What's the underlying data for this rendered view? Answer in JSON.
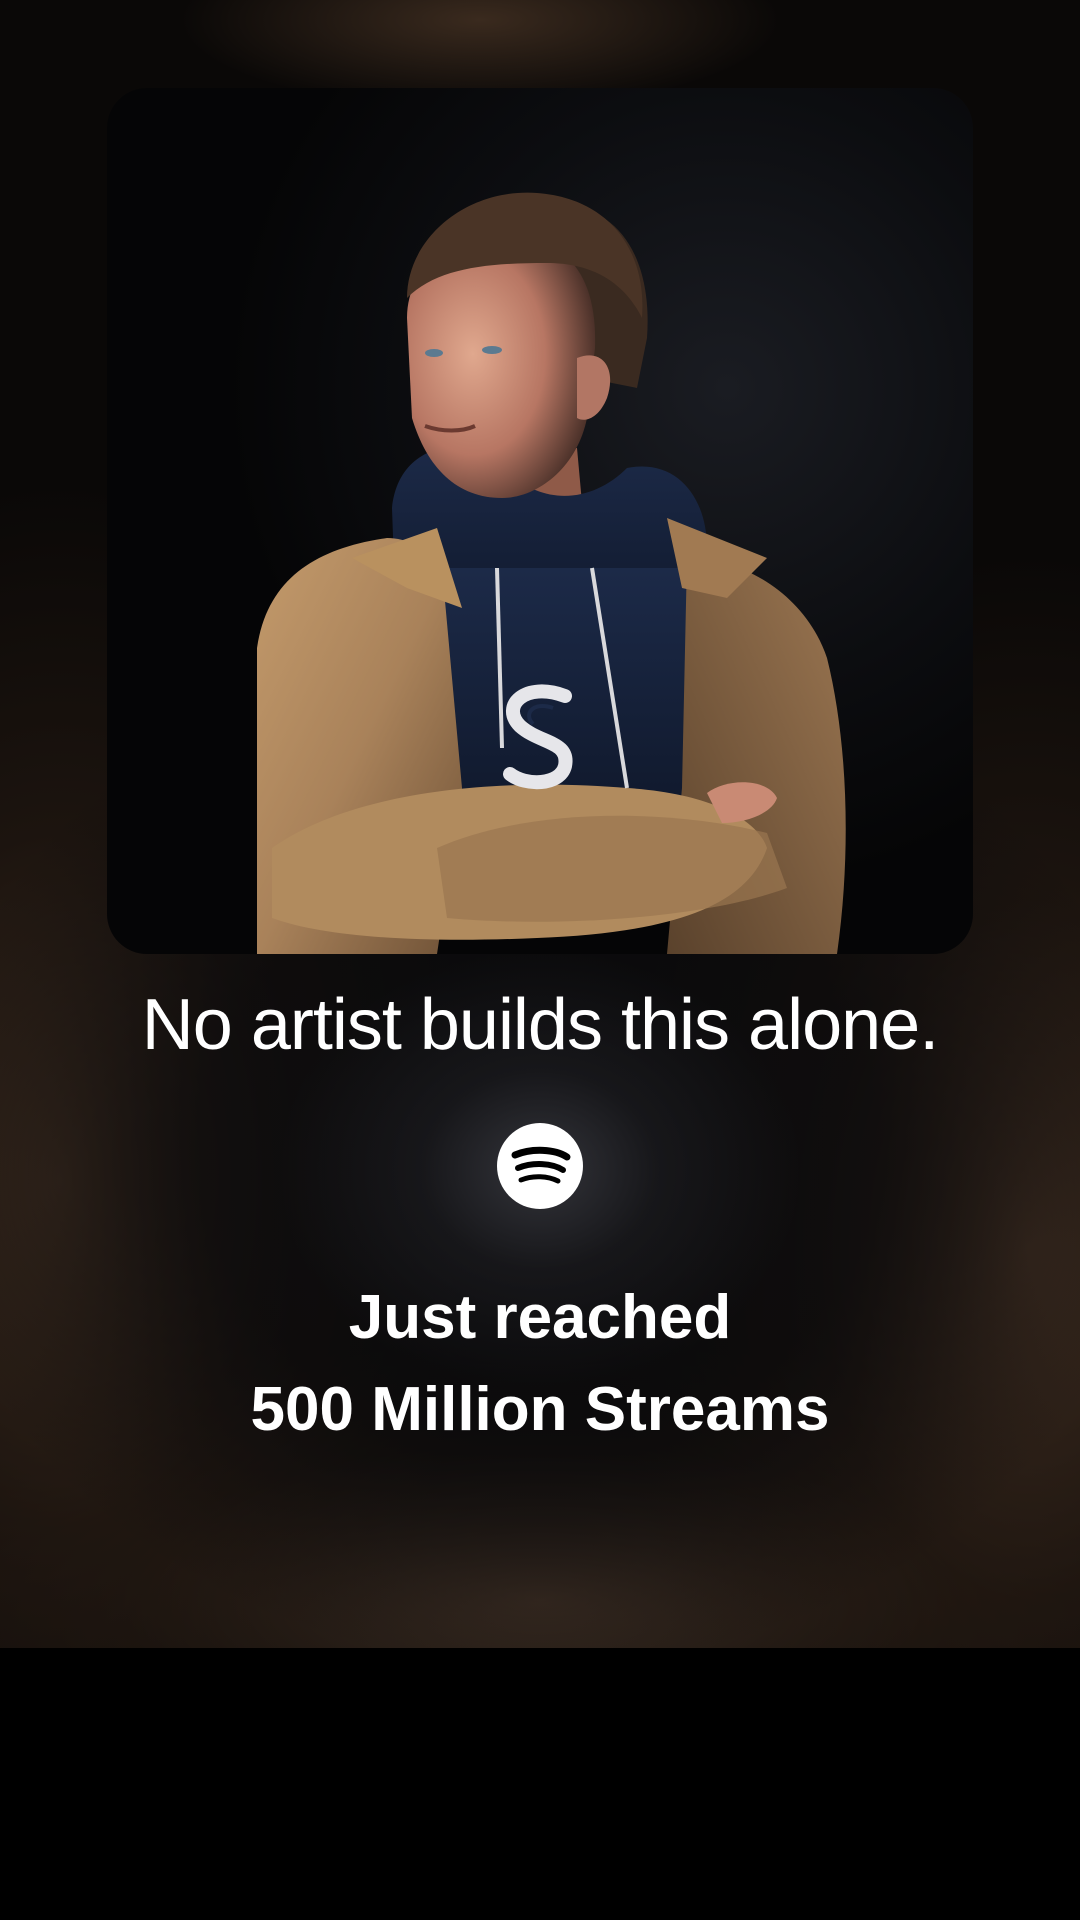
{
  "story": {
    "photo": {
      "subject": "artist-portrait",
      "shirt_logo_letter": "S"
    },
    "headline": "No artist builds this alone.",
    "logo_icon": "spotify-icon",
    "milestone": {
      "line1": "Just reached",
      "line2": "500 Million Streams"
    }
  },
  "colors": {
    "text": "#ffffff",
    "background": "#0a0807",
    "jacket": "#b08a5e",
    "hoodie": "#14203a"
  }
}
